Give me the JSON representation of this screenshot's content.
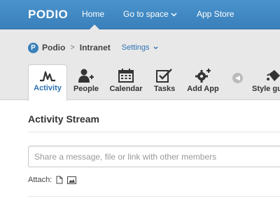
{
  "topbar": {
    "logo": "PODIO",
    "nav": [
      {
        "label": "Home"
      },
      {
        "label": "Go to space"
      },
      {
        "label": "App Store"
      }
    ]
  },
  "breadcrumb": {
    "org_icon_letter": "P",
    "org": "Podio",
    "separator": ">",
    "workspace": "Intranet",
    "settings": "Settings"
  },
  "tabs": [
    {
      "label": "Activity",
      "icon": "activity-icon",
      "active": true
    },
    {
      "label": "People",
      "icon": "add-person-icon"
    },
    {
      "label": "Calendar",
      "icon": "calendar-icon"
    },
    {
      "label": "Tasks",
      "icon": "checkbox-icon"
    },
    {
      "label": "Add App",
      "icon": "gear-plus-icon"
    },
    {
      "label": "Style gu",
      "icon": "paint-bucket-icon"
    }
  ],
  "stream": {
    "title": "Activity Stream",
    "share_placeholder": "Share a message, file or link with other members",
    "attach_label": "Attach:"
  },
  "colors": {
    "topbar": "#3a80bb",
    "link": "#2e72b3",
    "subheader_bg": "#e8e8e8"
  }
}
